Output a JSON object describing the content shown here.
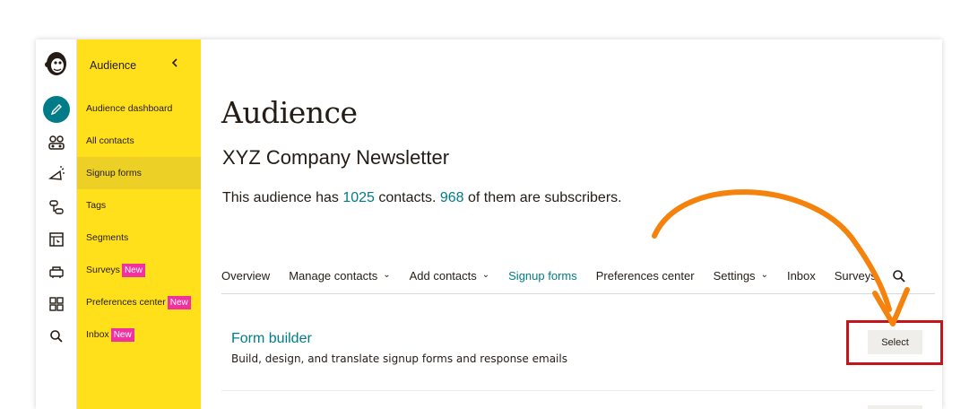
{
  "sidebar": {
    "header": "Audience",
    "items": [
      {
        "label": "Audience dashboard",
        "badge": ""
      },
      {
        "label": "All contacts",
        "badge": ""
      },
      {
        "label": "Signup forms",
        "badge": ""
      },
      {
        "label": "Tags",
        "badge": ""
      },
      {
        "label": "Segments",
        "badge": ""
      },
      {
        "label": "Surveys",
        "badge": "New"
      },
      {
        "label": "Preferences center",
        "badge": "New"
      },
      {
        "label": "Inbox",
        "badge": "New"
      }
    ],
    "active": "Signup forms"
  },
  "rail_icons": [
    "mailchimp-logo",
    "pencil-icon",
    "audience-icon",
    "campaigns-icon",
    "automations-icon",
    "website-icon",
    "integrations-icon",
    "content-icon",
    "search-icon"
  ],
  "main": {
    "title": "Audience",
    "subtitle": "XYZ Company Newsletter",
    "stats": {
      "prefix": "This audience has ",
      "contacts": "1025",
      "middle": " contacts. ",
      "subscribers": "968",
      "suffix": " of them are subscribers."
    },
    "tabs": [
      {
        "label": "Overview",
        "dropdown": false
      },
      {
        "label": "Manage contacts",
        "dropdown": true
      },
      {
        "label": "Add contacts",
        "dropdown": true
      },
      {
        "label": "Signup forms",
        "dropdown": false
      },
      {
        "label": "Preferences center",
        "dropdown": false
      },
      {
        "label": "Settings",
        "dropdown": true
      },
      {
        "label": "Inbox",
        "dropdown": false
      },
      {
        "label": "Surveys",
        "dropdown": false
      }
    ],
    "active_tab": "Signup forms",
    "form_builder": {
      "title": "Form builder",
      "description": "Build, design, and translate signup forms and response emails",
      "button": "Select"
    }
  },
  "colors": {
    "accent": "#007c89",
    "sidebar": "#ffe01b",
    "badge": "#f0319f",
    "arrow": "#f5820d",
    "highlight": "#c5151b"
  }
}
